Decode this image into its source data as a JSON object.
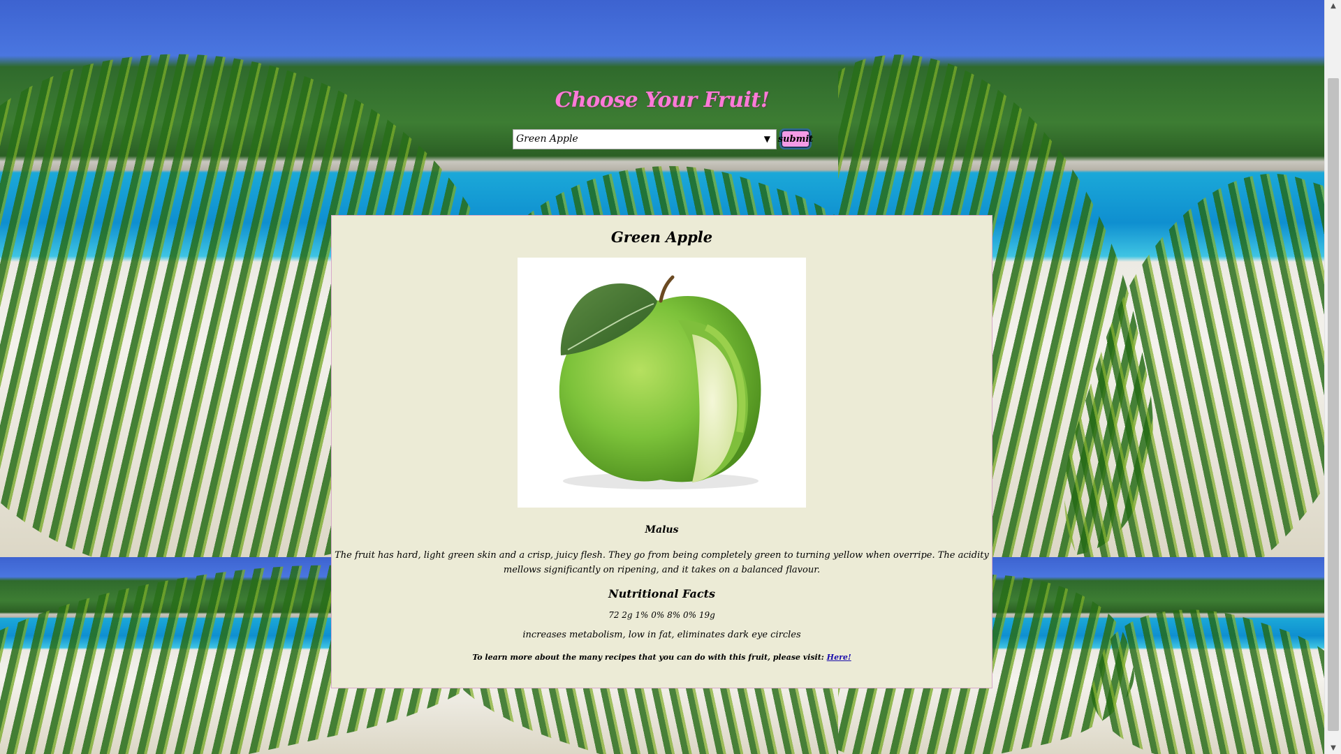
{
  "header": {
    "title": "Choose Your Fruit!"
  },
  "form": {
    "selected_fruit": "Green Apple",
    "submit_label": "submit"
  },
  "fruit": {
    "name": "Green Apple",
    "scientific_name": "Malus",
    "description": "The fruit has hard, light green skin and a crisp, juicy flesh. They go from being completely green to turning yellow when overripe. The acidity mellows significantly on ripening, and it takes on a balanced flavour.",
    "nutrition_heading": "Nutritional Facts",
    "nutrition_values": "72 2g 1% 0% 8% 0% 19g",
    "benefits": "increases metabolism, low in fat, eliminates dark eye circles",
    "recipes_text": "To learn more about the many recipes that you can do with this fruit, please visit: ",
    "recipes_link_label": "Here!"
  },
  "colors": {
    "title": "#ff7ad9",
    "card_background": "#ecebd6",
    "submit_button": "#f49be6",
    "link": "#1a0dab"
  }
}
